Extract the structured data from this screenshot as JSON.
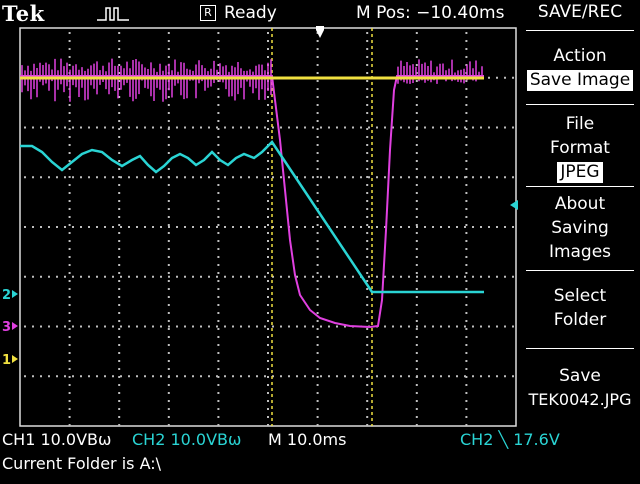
{
  "header": {
    "brand": "Tek",
    "trigger_icon": "trigger-waveform-icon",
    "acq_badge": "R",
    "acq_status": "Ready",
    "m_pos": "M Pos: −10.40ms"
  },
  "menu": {
    "title": "SAVE/REC",
    "items": [
      {
        "label": "Action",
        "value": "Save Image"
      },
      {
        "label": "File Format",
        "value": "JPEG"
      },
      {
        "label": "About Saving Images"
      },
      {
        "label": "Select Folder"
      },
      {
        "label": "Save",
        "sub": "TEK0042.JPG"
      }
    ]
  },
  "status": {
    "ch1": "CH1  10.0V",
    "ch1_suffix": "Bω",
    "ch2": "CH2  10.0V",
    "ch2_suffix": "Bω",
    "timebase": "M 10.0ms",
    "trigger": "CH2 ╲ 17.6V",
    "folder": "Current Folder is A:\\"
  },
  "markers": {
    "ch1": "1",
    "ch2": "2",
    "ch3": "3"
  },
  "colors": {
    "ch1": "#f0e040",
    "ch2": "#2ad4d4",
    "ch3": "#e040e0",
    "grid": "#cfcfcf"
  }
}
